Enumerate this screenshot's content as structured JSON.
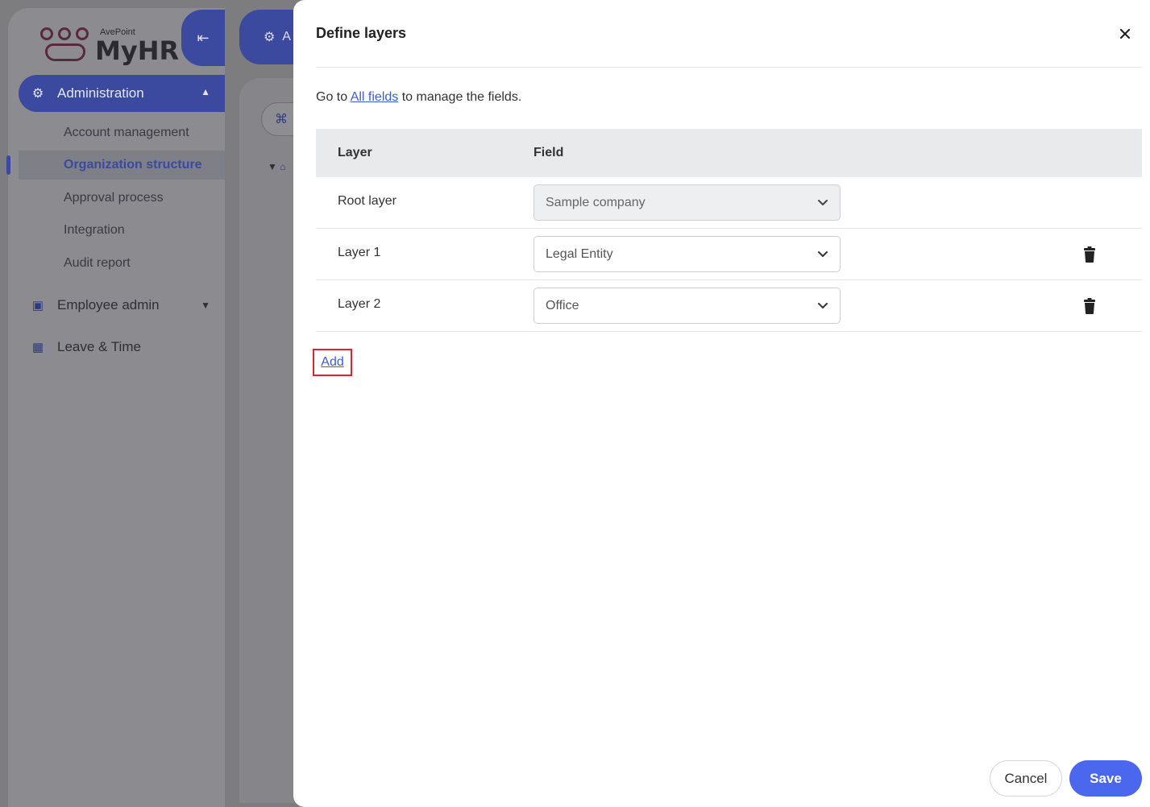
{
  "app": {
    "company_mark": "AvePoint",
    "brand": "MyHR"
  },
  "sidebar": {
    "admin_label": "Administration",
    "sub_items": [
      {
        "label": "Account management"
      },
      {
        "label": "Organization structure",
        "active": true
      },
      {
        "label": "Approval process"
      },
      {
        "label": "Integration"
      },
      {
        "label": "Audit report"
      }
    ],
    "items": [
      {
        "label": "Employee admin",
        "icon": "id-badge-icon"
      },
      {
        "label": "Leave & Time",
        "icon": "calendar-icon"
      }
    ]
  },
  "main": {
    "tab_label": "A"
  },
  "drawer": {
    "title": "Define layers",
    "hint_prefix": "Go to",
    "hint_link": "All fields",
    "hint_suffix": "to manage the fields.",
    "columns": {
      "layer": "Layer",
      "field": "Field"
    },
    "rows": [
      {
        "layer": "Root layer",
        "field": "Sample company",
        "disabled": true,
        "deletable": false
      },
      {
        "layer": "Layer 1",
        "field": "Legal Entity",
        "disabled": false,
        "deletable": true
      },
      {
        "layer": "Layer 2",
        "field": "Office",
        "disabled": false,
        "deletable": true
      }
    ],
    "add_label": "Add",
    "cancel_label": "Cancel",
    "save_label": "Save"
  },
  "colors": {
    "accent": "#4a67ee",
    "link": "#3f5bd8",
    "highlight_border": "#d9282c",
    "sidebar_active": "#3b4a9e"
  }
}
